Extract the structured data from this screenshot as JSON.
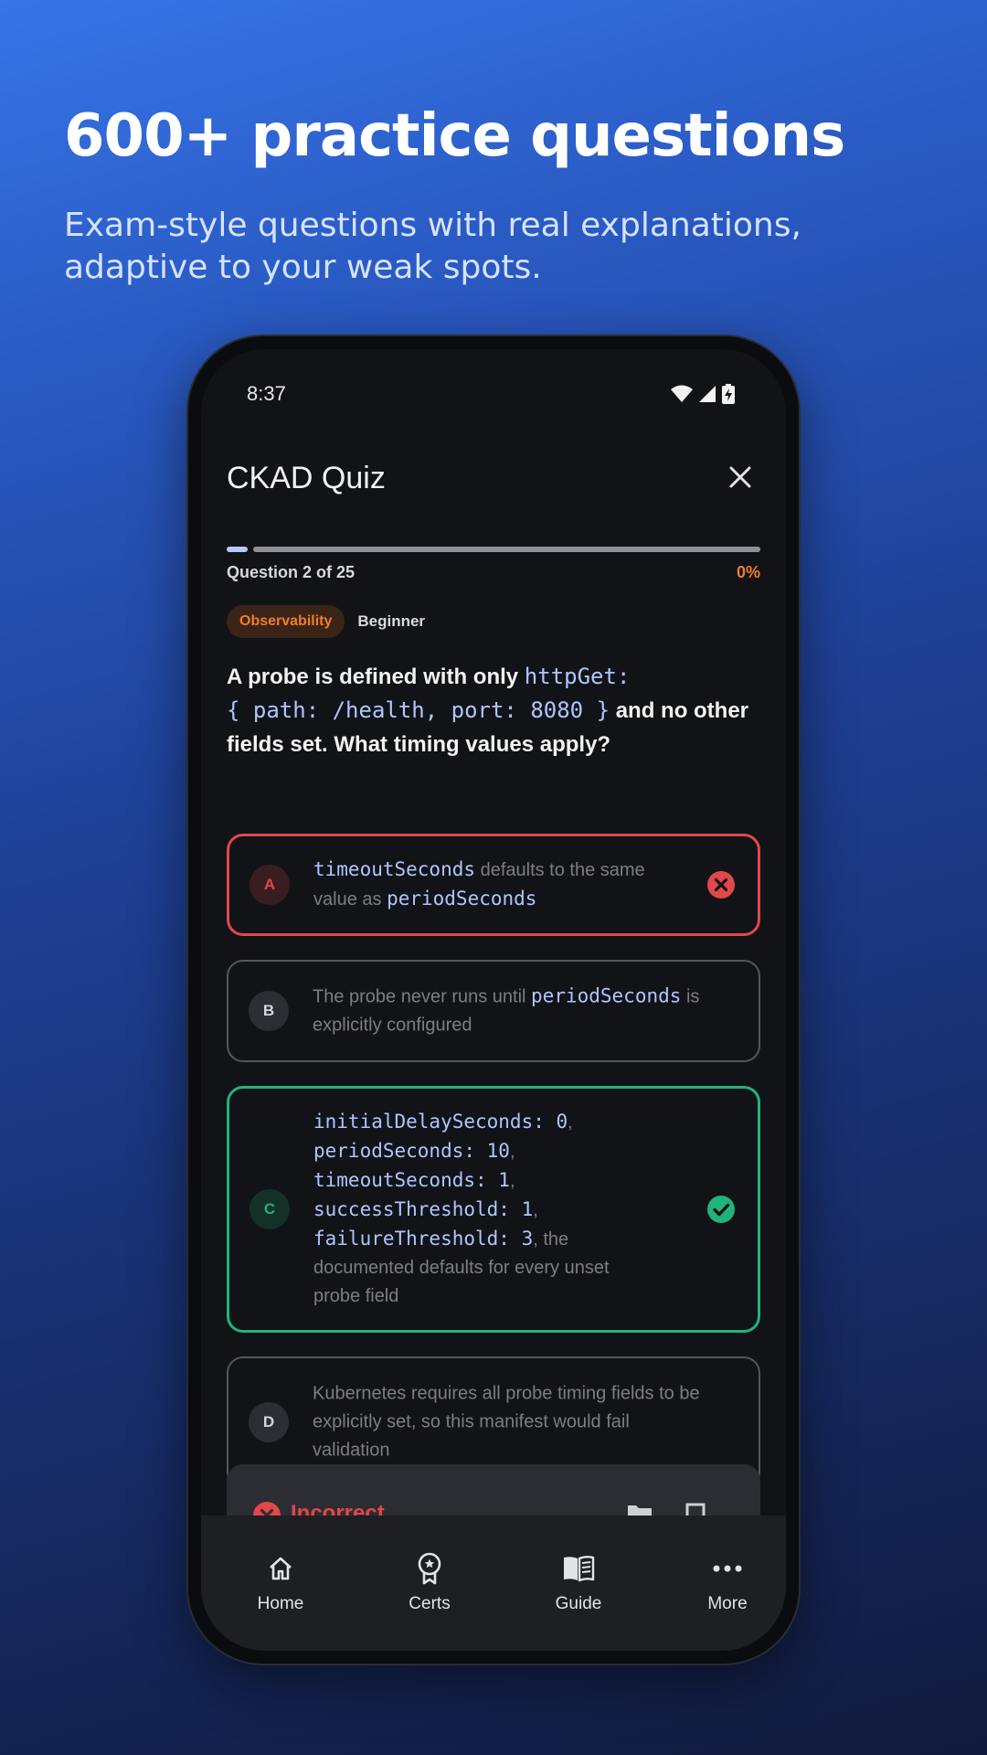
{
  "promo": {
    "headline": "600+ practice questions",
    "subhead_line1": "Exam-style questions with real explanations,",
    "subhead_line2": "adaptive to your weak spots."
  },
  "status_bar": {
    "time": "8:37",
    "icons": [
      "wifi-icon",
      "cell-signal-icon",
      "battery-charging-icon"
    ]
  },
  "app_bar": {
    "title": "CKAD Quiz",
    "close_icon": "close-icon"
  },
  "progress": {
    "label": "Question 2 of 25",
    "percent_text": "0%",
    "current_question": 2,
    "total_questions": 25
  },
  "tags": {
    "domain": "Observability",
    "level": "Beginner"
  },
  "question": {
    "text_1": "A probe is defined with only ",
    "code_1": "httpGet:",
    "code_2": "{ path: /health, port: 8080 }",
    "text_2": " and no other",
    "text_3": "fields set. What timing values apply?"
  },
  "options": [
    {
      "letter": "A",
      "state": "wrong",
      "code_1": "timeoutSeconds",
      "text_1": " defaults to the same",
      "text_2": "value as ",
      "code_2": "periodSeconds",
      "status_icon": "error-circle-icon"
    },
    {
      "letter": "B",
      "state": "neutral",
      "text_1": "The probe never runs until ",
      "code_1": "periodSeconds",
      "text_2": " is",
      "text_3": "explicitly configured"
    },
    {
      "letter": "C",
      "state": "correct",
      "code_1": "initialDelaySeconds: 0",
      "code_2": "periodSeconds: 10",
      "code_3": "timeoutSeconds: 1",
      "code_4": "successThreshold: 1",
      "code_5": "failureThreshold: 3",
      "comma": ",",
      "text_1": ", the",
      "text_2": "documented defaults for every unset",
      "text_3": "probe field",
      "status_icon": "check-circle-icon"
    },
    {
      "letter": "D",
      "state": "neutral",
      "text_1": "Kubernetes requires all probe timing fields to be",
      "text_2": "explicitly set, so this manifest would fail",
      "text_3": "validation"
    }
  ],
  "result": {
    "label": "Incorrect",
    "icon": "error-circle-icon",
    "actions": [
      "folder-icon",
      "bookmark-icon"
    ]
  },
  "bottom_nav": [
    {
      "label": "Home",
      "icon": "home-icon"
    },
    {
      "label": "Certs",
      "icon": "certificate-badge-icon"
    },
    {
      "label": "Guide",
      "icon": "book-icon"
    },
    {
      "label": "More",
      "icon": "more-horizontal-icon"
    }
  ],
  "colors": {
    "accent_orange": "#f07c2c",
    "wrong_red": "#e2474b",
    "correct_green": "#1fb47c",
    "code_blue": "#aec6ff",
    "progress_active": "#b8c8ff",
    "progress_track": "#8e9098"
  }
}
